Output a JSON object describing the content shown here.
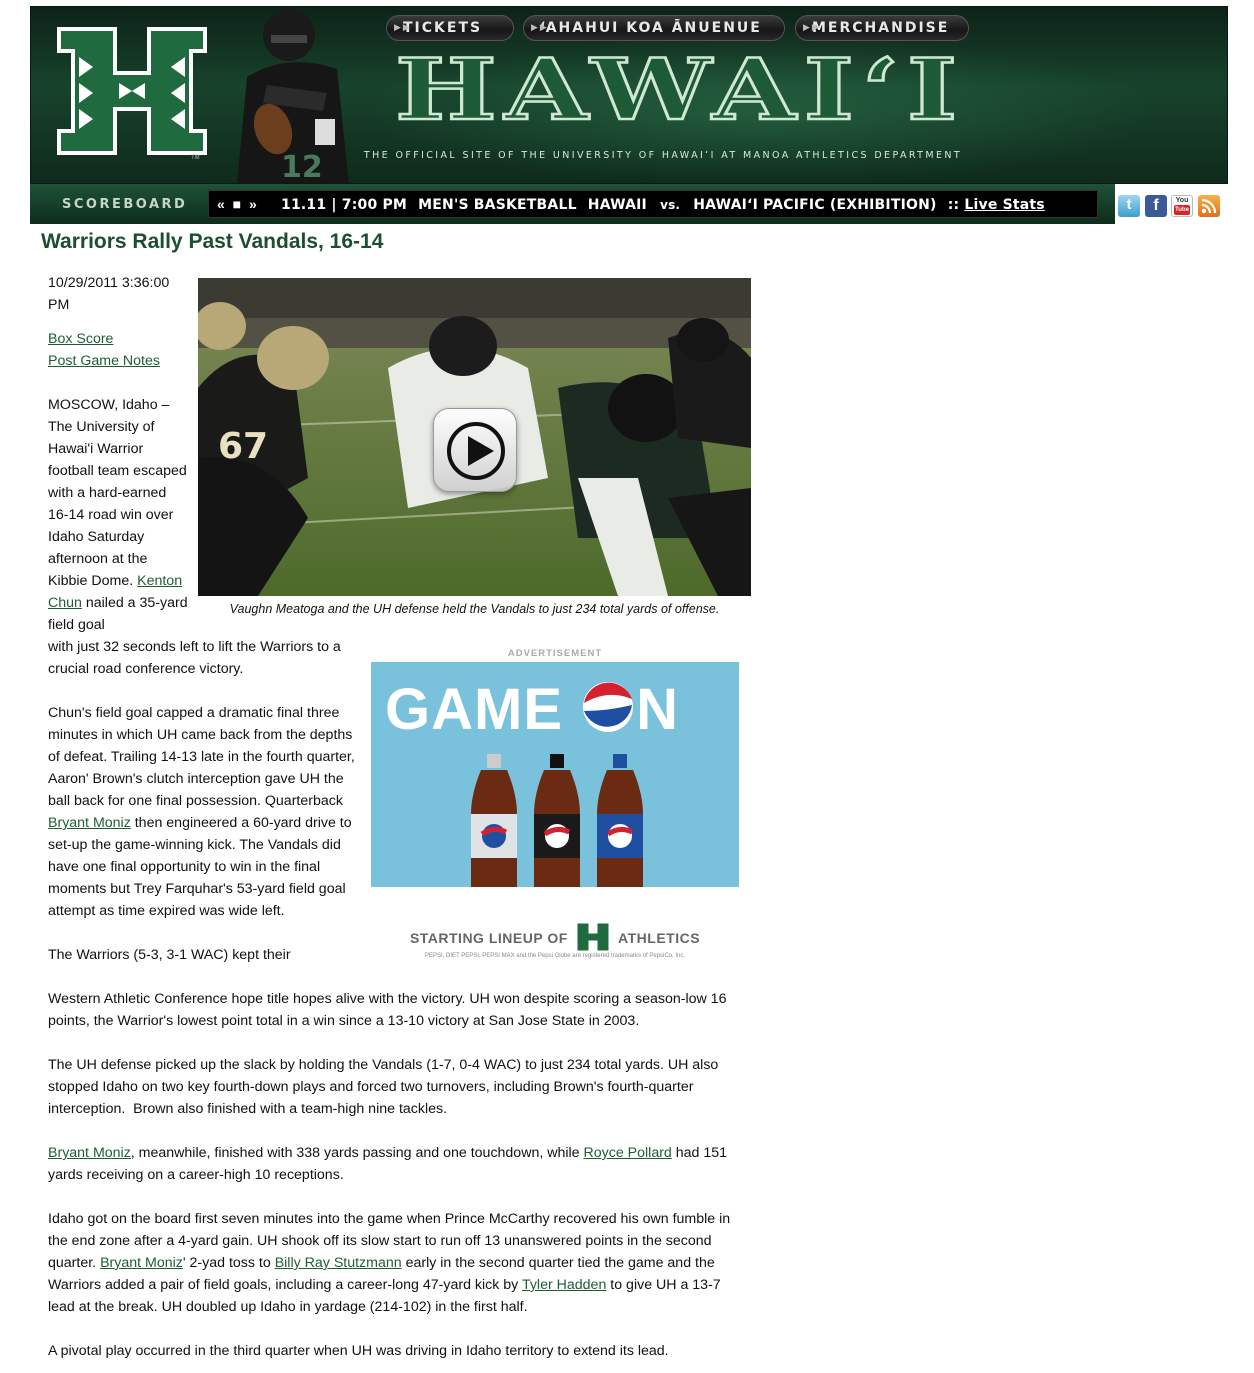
{
  "header": {
    "nav": [
      {
        "label": "TICKETS"
      },
      {
        "label": "‘AHAHUI KOA ĀNUENUE"
      },
      {
        "label": "MERCHANDISE"
      }
    ],
    "wordmark": "HAWAIʻI",
    "tagline": "THE OFFICIAL SITE OF THE UNIVERSITY OF HAWAIʻI AT MANOA ATHLETICS DEPARTMENT",
    "colors": {
      "banner": "#17432c",
      "accent": "#1d4e30"
    }
  },
  "scoreboard": {
    "label": "SCOREBOARD",
    "controls": "« ■ »",
    "date": "11.11",
    "time": "7:00 PM",
    "event": "MEN'S BASKETBALL",
    "team1": "HAWAII",
    "vs": "vs.",
    "team2": "HAWAIʻI PACIFIC (EXHIBITION)",
    "sep": "::",
    "live_stats": "Live Stats"
  },
  "social": [
    "twitter-icon",
    "facebook-icon",
    "youtube-icon",
    "rss-icon"
  ],
  "article": {
    "headline": "Warriors Rally Past Vandals, 16-14",
    "date": "10/29/2011 3:36:00 PM",
    "links": [
      "Box Score",
      "Post Game Notes"
    ],
    "photo_caption": "Vaughn Meatoga and the UH defense held the Vandals to just 234 total yards of offense.",
    "p1": {
      "a": "MOSCOW, Idaho – The University of Hawai'i Warrior football team escaped with a hard-earned 16-14 road win over Idaho Saturday afternoon at the Kibbie Dome.",
      "link": "Kenton Chun",
      "b": " nailed a 35-yard field goal",
      "c": "with just 32 seconds left to lift the Warriors to a crucial road conference victory."
    },
    "p2": {
      "a": "Chun's field goal capped a dramatic final three minutes in which UH came back from the depths of defeat. Trailing 14-13 late in the fourth quarter, Aaron' Brown's clutch interception gave UH the ball back for one final possession. Quarterback ",
      "link": "Bryant Moniz",
      "b": " then engineered a 60-yard drive to set-up the game-winning kick. The Vandals did have one final opportunity to win in the final moments but Trey Farquhar's 53-yard field goal attempt as time expired was wide left."
    },
    "p3": {
      "a": "The Warriors (5-3, 3-1 WAC) kept their",
      "b": "Western Athletic Conference hope title hopes alive with the victory. UH won despite scoring a season-low 16 points, the Warrior's lowest point total in a win since a 13-10 victory at San Jose State in 2003."
    },
    "p4": "The UH defense picked up the slack by holding the Vandals (1-7, 0-4 WAC) to just 234 total yards. UH also stopped Idaho on two key fourth-down plays and forced two turnovers, including Brown's fourth-quarter interception.  Brown also finished with a team-high nine tackles.",
    "p5": {
      "link1": "Bryant Moniz",
      "a": ", meanwhile, finished with 338 yards passing and one touchdown, while ",
      "link2": "Royce Pollard",
      "b": " had 151 yards receiving on a career-high 10 receptions."
    },
    "p6": {
      "a": "Idaho got on the board first seven minutes into the game when Prince McCarthy recovered his own fumble in the end zone after a 4-yard gain. UH shook off its slow start to run off 13 unanswered points in the second quarter. ",
      "link1": "Bryant Moniz",
      "b": "' 2-yad toss to ",
      "link2": "Billy Ray Stutzmann",
      "c": " early in the second quarter tied the game and the Warriors added a pair of field goals, including a career-long 47-yard kick by ",
      "link3": "Tyler Hadden",
      "d": " to give UH a 13-7 lead at the break. UH doubled up Idaho in yardage (214-102) in the first half."
    },
    "p7": "A pivotal play occurred in the third quarter when UH was driving in Idaho territory to extend its lead."
  },
  "ad": {
    "label": "ADVERTISEMENT",
    "headline_a": "GAME ",
    "headline_b": "N",
    "footer_a": "STARTING LINEUP OF",
    "footer_b": "ATHLETICS",
    "legal": "PEPSI, DIET PEPSI, PEPSI MAX and the Pepsi Globe are registered trademarks of PepsiCo, Inc.",
    "colors": {
      "bg": "#7ac1dc",
      "pepsi_blue": "#1f4fa0",
      "pepsi_red": "#d62030"
    }
  }
}
